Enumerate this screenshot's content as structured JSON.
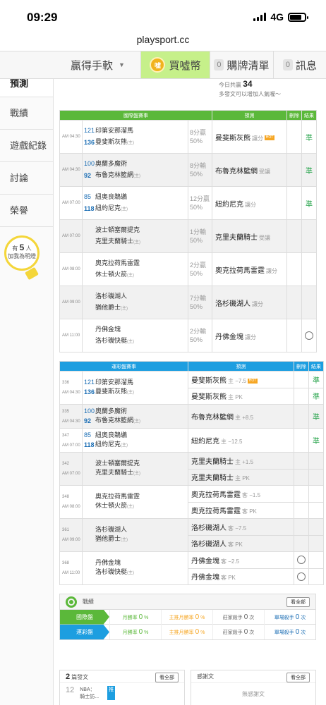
{
  "status_bar": {
    "time": "09:29",
    "network": "4G"
  },
  "browser": {
    "url": "playsport.cc"
  },
  "topnav": {
    "app_label": "贏得手軟",
    "coin_icon_text": "噓",
    "coin_label": "買噓幣",
    "cart_count": "0",
    "cart_label": "購牌清單",
    "msg_count": "0",
    "msg_label": "訊息"
  },
  "sidebar": {
    "items": [
      "預測",
      "戰績",
      "遊戲紀錄",
      "討論",
      "榮譽"
    ],
    "bulb": {
      "prefix": "有",
      "count": "5",
      "suffix": "人",
      "line2": "加我為明燈"
    }
  },
  "notice": {
    "line1_prefix": "今日共贏",
    "line1_value": "34",
    "line2": "多發文可以增加人氣喔～"
  },
  "table1": {
    "headers": [
      "國際盤賽事",
      "預測",
      "刪除",
      "結果"
    ],
    "rows": [
      {
        "time": "AM 04:30",
        "n1": "121",
        "t1": "印第安那溜馬",
        "n2": "136",
        "t2": "曼斐斯灰熊",
        "h2": "(主)",
        "odds1": "8分贏",
        "odds2": "50%",
        "pick": "曼斐斯灰熊",
        "pick_sub": "讓分",
        "hot": "HOT",
        "result": "準",
        "gray": false
      },
      {
        "time": "AM 04:30",
        "n1": "100",
        "t1": "奧蘭多魔術",
        "n2": "92",
        "t2": "布魯克林籃網",
        "h2": "(主)",
        "odds1": "8分輸",
        "odds2": "50%",
        "pick": "布魯克林籃網",
        "pick_sub": "受讓",
        "result": "準",
        "gray": true
      },
      {
        "time": "AM 07:00",
        "n1": "85",
        "t1": "紐奧良鵜鶘",
        "n2": "118",
        "t2": "紐約尼克",
        "h2": "(主)",
        "odds1": "12分贏",
        "odds2": "50%",
        "pick": "紐約尼克",
        "pick_sub": "讓分",
        "result": "準",
        "gray": false
      },
      {
        "time": "AM 07:00",
        "n1": "",
        "t1": "波士頓塞爾提克",
        "n2": "",
        "t2": "克里夫蘭騎士",
        "h2": "(主)",
        "odds1": "1分輸",
        "odds2": "50%",
        "pick": "克里夫蘭騎士",
        "pick_sub": "受讓",
        "result": "",
        "gray": true
      },
      {
        "time": "AM 08:00",
        "n1": "",
        "t1": "奧克拉荷馬雷霆",
        "n2": "",
        "t2": "休士頓火箭",
        "h2": "(主)",
        "odds1": "2分贏",
        "odds2": "50%",
        "pick": "奧克拉荷馬雷霆",
        "pick_sub": "讓分",
        "result": "",
        "gray": false
      },
      {
        "time": "AM 09:00",
        "n1": "",
        "t1": "洛杉磯湖人",
        "n2": "",
        "t2": "猶他爵士",
        "h2": "(主)",
        "odds1": "7分輸",
        "odds2": "50%",
        "pick": "洛杉磯湖人",
        "pick_sub": "讓分",
        "result": "",
        "gray": true
      },
      {
        "time": "AM 11:00",
        "n1": "",
        "t1": "丹佛金塊",
        "n2": "",
        "t2": "洛杉磯快艇",
        "h2": "(主)",
        "odds1": "2分輸",
        "odds2": "50%",
        "pick": "丹佛金塊",
        "pick_sub": "讓分",
        "result": "",
        "gray": false,
        "deletable": true
      }
    ]
  },
  "table2": {
    "headers": [
      "運彩盤賽事",
      "預測",
      "刪除",
      "結果"
    ],
    "rows": [
      {
        "code": "336",
        "time": "AM 04:30",
        "n1": "121",
        "t1": "印第安那溜馬",
        "n2": "136",
        "t2": "曼斐斯灰熊",
        "h2": "(主)",
        "gray": false,
        "picks": [
          {
            "team": "曼斐斯灰熊",
            "sub": "主 −7.5",
            "hot": "HOT",
            "result": "準"
          },
          {
            "team": "曼斐斯灰熊",
            "sub": "主 PK",
            "result": "準"
          }
        ]
      },
      {
        "code": "335",
        "time": "AM 04:30",
        "n1": "100",
        "t1": "奧蘭多魔術",
        "n2": "92",
        "t2": "布魯克林籃網",
        "h2": "(主)",
        "gray": true,
        "picks": [
          {
            "team": "布魯克林籃網",
            "sub": "主 +8.5",
            "result": "準"
          }
        ]
      },
      {
        "code": "347",
        "time": "AM 07:00",
        "n1": "85",
        "t1": "紐奧良鵜鶘",
        "n2": "118",
        "t2": "紐約尼克",
        "h2": "(主)",
        "gray": false,
        "picks": [
          {
            "team": "紐約尼克",
            "sub": "主 −12.5",
            "result": "準"
          }
        ]
      },
      {
        "code": "342",
        "time": "AM 07:00",
        "n1": "",
        "t1": "波士頓塞爾提克",
        "n2": "",
        "t2": "克里夫蘭騎士",
        "h2": "(主)",
        "gray": true,
        "picks": [
          {
            "team": "克里夫蘭騎士",
            "sub": "主 +1.5",
            "result": ""
          },
          {
            "team": "克里夫蘭騎士",
            "sub": "主 PK",
            "result": ""
          }
        ]
      },
      {
        "code": "348",
        "time": "AM 08:00",
        "n1": "",
        "t1": "奧克拉荷馬雷霆",
        "n2": "",
        "t2": "休士頓火箭",
        "h2": "(主)",
        "gray": false,
        "picks": [
          {
            "team": "奧克拉荷馬雷霆",
            "sub": "客 −1.5",
            "result": ""
          },
          {
            "team": "奧克拉荷馬雷霆",
            "sub": "客 PK",
            "result": ""
          }
        ]
      },
      {
        "code": "361",
        "time": "AM 09:00",
        "n1": "",
        "t1": "洛杉磯湖人",
        "n2": "",
        "t2": "猶他爵士",
        "h2": "(主)",
        "gray": true,
        "picks": [
          {
            "team": "洛杉磯湖人",
            "sub": "客 −7.5",
            "result": ""
          },
          {
            "team": "洛杉磯湖人",
            "sub": "客 PK",
            "result": ""
          }
        ]
      },
      {
        "code": "368",
        "time": "AM 11:00",
        "n1": "",
        "t1": "丹佛金塊",
        "n2": "",
        "t2": "洛杉磯快艇",
        "h2": "(主)",
        "gray": false,
        "picks": [
          {
            "team": "丹佛金塊",
            "sub": "客 −2.5",
            "result": "",
            "deletable": true
          },
          {
            "team": "丹佛金塊",
            "sub": "客 PK",
            "result": "",
            "deletable": true
          }
        ]
      }
    ]
  },
  "record": {
    "title": "戰績",
    "view_all": "看全部",
    "rows": [
      {
        "label": "國際盤",
        "cells": [
          {
            "k": "月勝率",
            "v": "0",
            "u": "%"
          },
          {
            "k": "主推月勝率",
            "v": "0",
            "u": "%"
          },
          {
            "k": "莊家殺手",
            "v": "0",
            "u": "次"
          },
          {
            "k": "單場殺手",
            "v": "0",
            "u": "次"
          }
        ]
      },
      {
        "label": "運彩盤",
        "cells": [
          {
            "k": "月勝率",
            "v": "0",
            "u": "%"
          },
          {
            "k": "主推月勝率",
            "v": "0",
            "u": "%"
          },
          {
            "k": "莊家殺手",
            "v": "0",
            "u": "次"
          },
          {
            "k": "單場殺手",
            "v": "0",
            "u": "次"
          }
        ]
      }
    ]
  },
  "posts": {
    "count": "2",
    "label": "篇發文",
    "view_all": "看全部",
    "item_day": "12",
    "item_league": "NBA：",
    "item_title": "騎士訪..."
  },
  "news": {
    "label": "感謝文",
    "view_all": "看全部",
    "empty": "無感謝文"
  },
  "colors": {
    "intl_green": "#5bb83a",
    "lottery_blue": "#1d9ee0",
    "hit_green": "#2aa54e",
    "hot_orange": "#f6a623",
    "coin_green": "#c6f08a"
  }
}
